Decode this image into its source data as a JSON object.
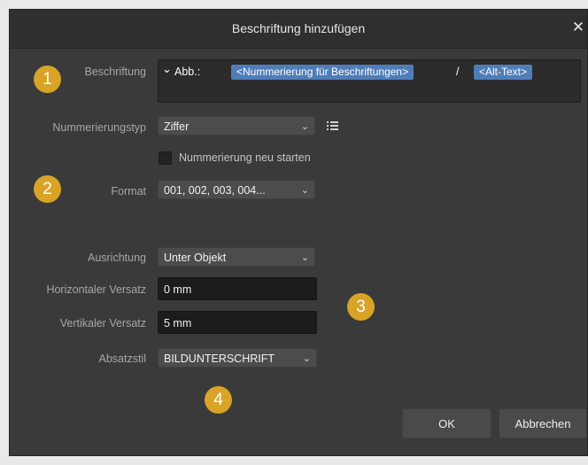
{
  "dialog": {
    "title": "Beschriftung hinzufügen",
    "close_symbol": "✕"
  },
  "caption": {
    "label": "Beschriftung",
    "chevron": "⌄",
    "prefix": "Abb.:",
    "numbering_token": "<Nummerierung für Beschriftungen>",
    "separator": "/",
    "alt_token": "<Alt-Text>"
  },
  "numbering_type": {
    "label": "Nummerierungstyp",
    "value": "Ziffer",
    "list_icon": "list-settings-icon"
  },
  "restart_numbering": {
    "label": "Nummerierung neu starten",
    "checked": false
  },
  "format": {
    "label": "Format",
    "value": "001, 002, 003, 004..."
  },
  "alignment": {
    "label": "Ausrichtung",
    "value": "Unter Objekt"
  },
  "horizontal_offset": {
    "label": "Horizontaler Versatz",
    "value": "0 mm"
  },
  "vertical_offset": {
    "label": "Vertikaler Versatz",
    "value": "5 mm"
  },
  "paragraph_style": {
    "label": "Absatzstil",
    "value": "BILDUNTERSCHRIFT"
  },
  "badges": [
    "1",
    "2",
    "3",
    "4"
  ],
  "buttons": {
    "ok": "OK",
    "cancel": "Abbrechen"
  },
  "colors": {
    "badge": "#d8a326",
    "token": "#4f7db8",
    "dialog_bg": "#3a3a3a"
  }
}
